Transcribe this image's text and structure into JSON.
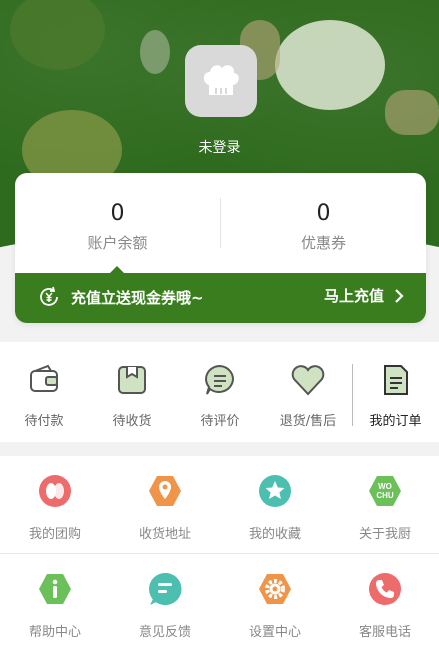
{
  "header": {
    "login_text": "未登录",
    "bg_color": "#2f6b1e"
  },
  "balance": {
    "account_value": "0",
    "account_label": "账户余额",
    "coupon_value": "0",
    "coupon_label": "优惠券"
  },
  "promo": {
    "text": "充值立送现金券哦~",
    "action": "马上充值",
    "icon": "yen-refresh-icon",
    "color": "#3a7d1f"
  },
  "orders": {
    "items": [
      {
        "label": "待付款",
        "icon": "wallet-icon"
      },
      {
        "label": "待收货",
        "icon": "box-icon"
      },
      {
        "label": "待评价",
        "icon": "comment-icon"
      },
      {
        "label": "退货/售后",
        "icon": "heart-icon"
      },
      {
        "label": "我的订单",
        "icon": "document-icon"
      }
    ]
  },
  "grid": {
    "items": [
      {
        "label": "我的团购",
        "icon": "group-buy-icon",
        "color": "#ee6b6b"
      },
      {
        "label": "收货地址",
        "icon": "location-icon",
        "color": "#f0944a"
      },
      {
        "label": "我的收藏",
        "icon": "star-icon",
        "color": "#4dbfb0"
      },
      {
        "label": "关于我厨",
        "icon": "wochu-icon",
        "color": "#6bc05a",
        "badge": "WO CHU"
      },
      {
        "label": "帮助中心",
        "icon": "info-icon",
        "color": "#6bc05a"
      },
      {
        "label": "意见反馈",
        "icon": "feedback-icon",
        "color": "#4dbfb0"
      },
      {
        "label": "设置中心",
        "icon": "settings-icon",
        "color": "#f0944a"
      },
      {
        "label": "客服电话",
        "icon": "phone-icon",
        "color": "#ee6b6b"
      }
    ]
  }
}
